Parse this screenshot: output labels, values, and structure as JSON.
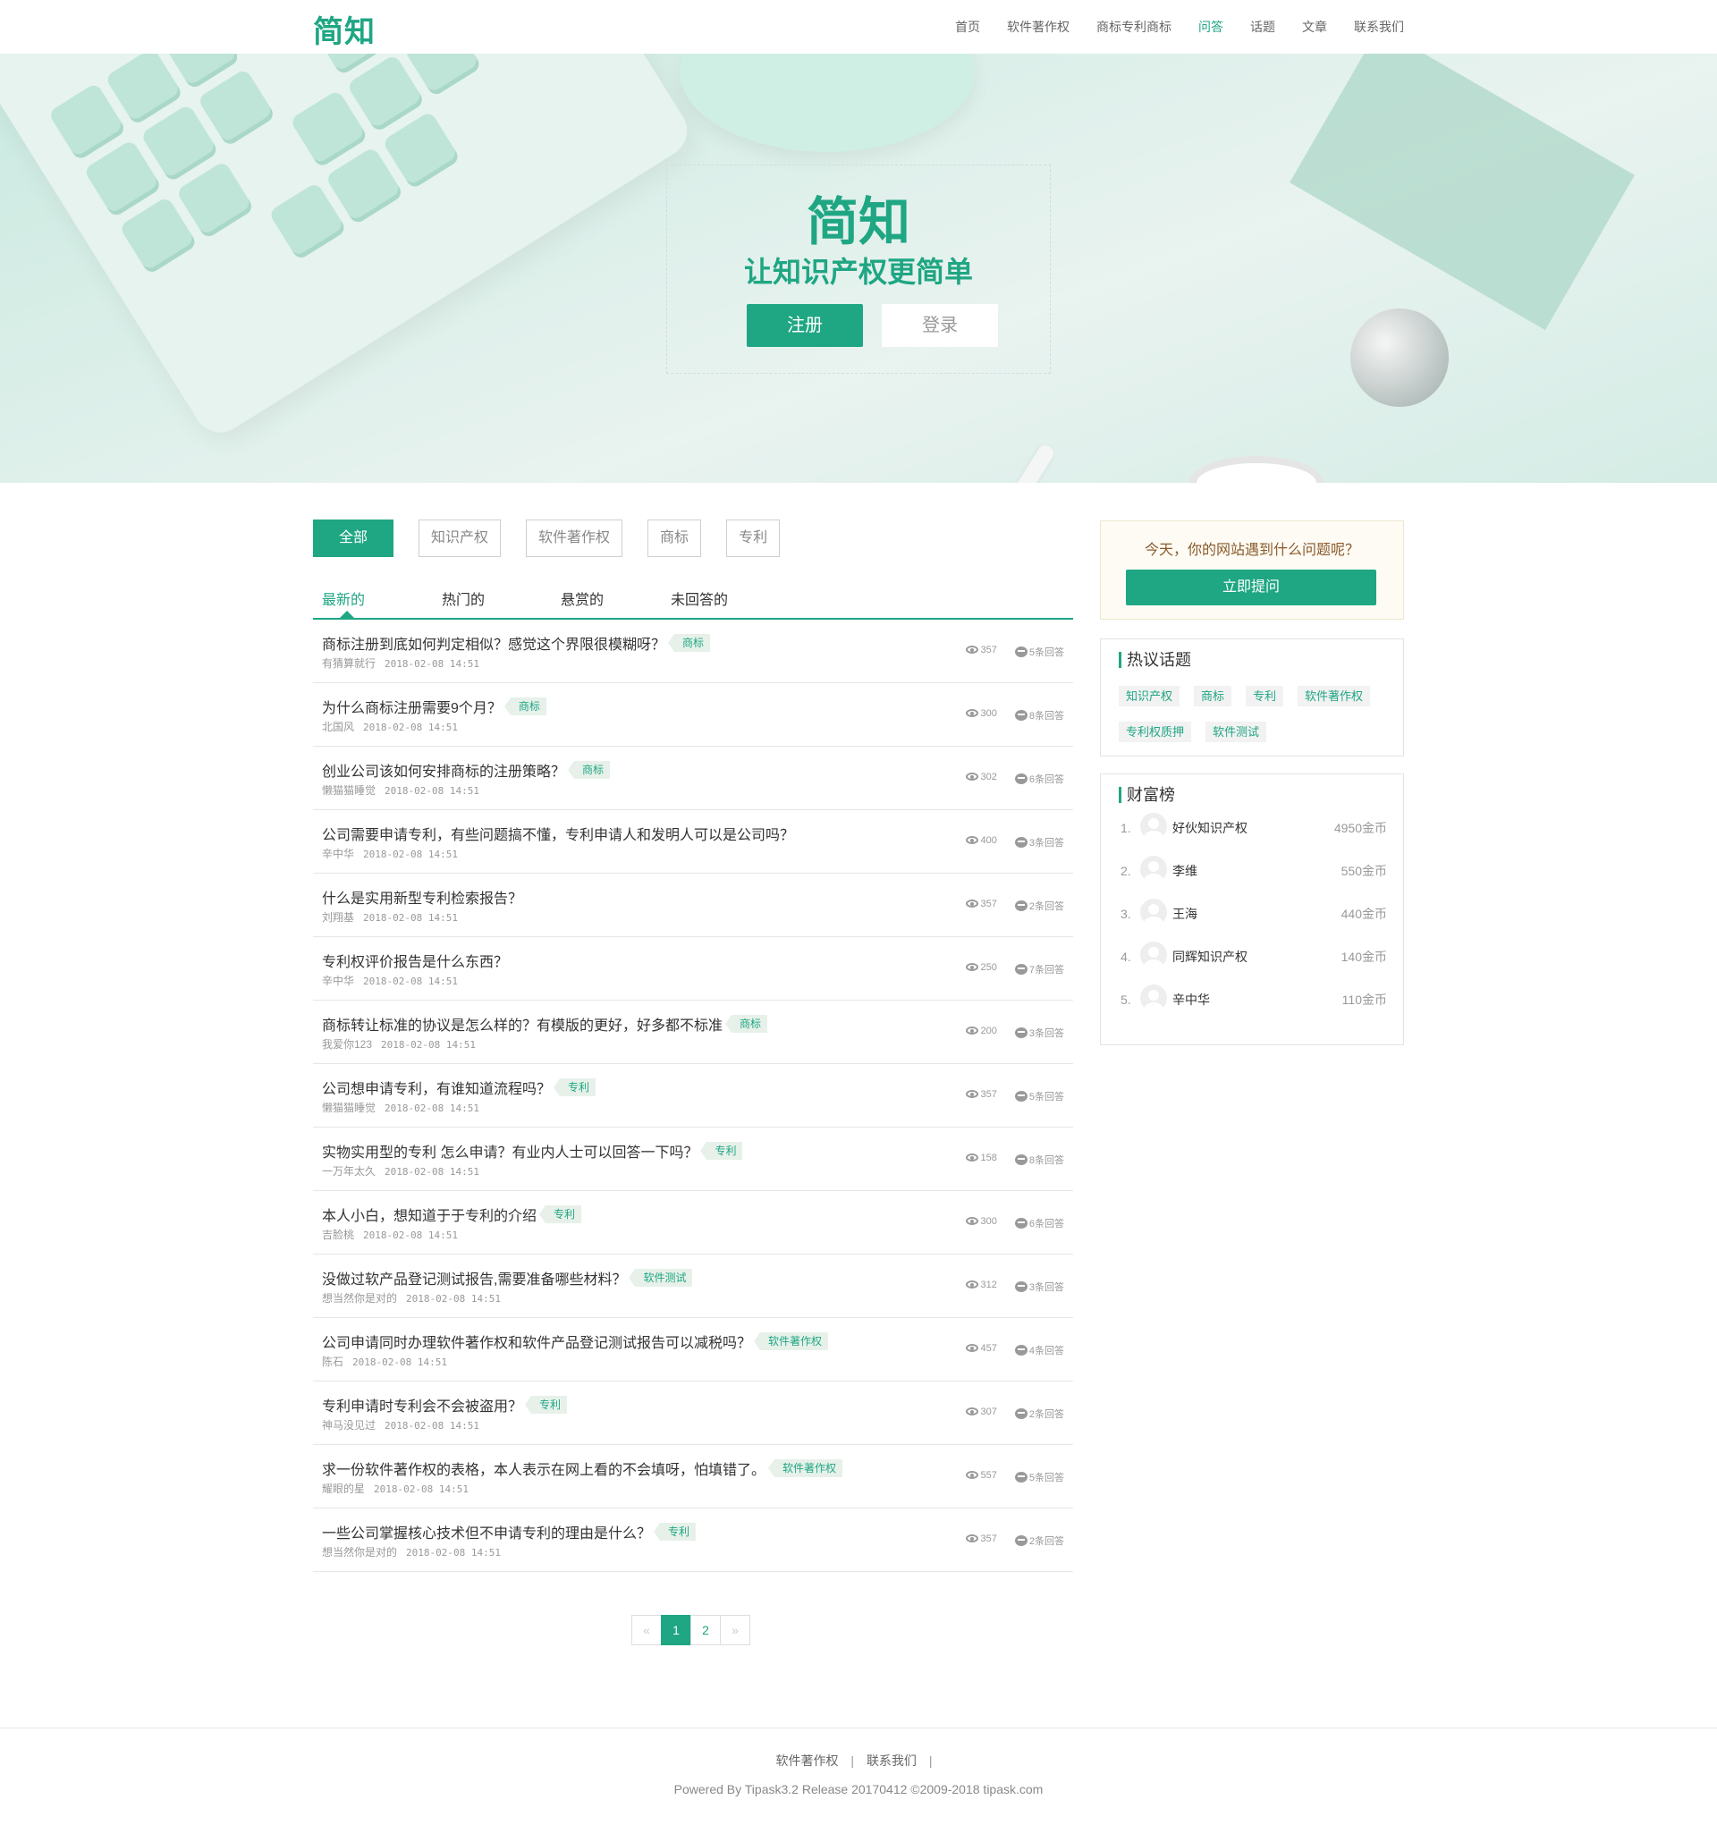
{
  "header": {
    "logo": "简知",
    "nav": [
      "首页",
      "软件著作权",
      "商标专利商标",
      "问答",
      "话题",
      "文章",
      "联系我们"
    ],
    "active_nav": "问答"
  },
  "hero": {
    "title": "简知",
    "subtitle": "让知识产权更简单",
    "register_label": "注册",
    "login_label": "登录"
  },
  "filters": [
    "全部",
    "知识产权",
    "软件著作权",
    "商标",
    "专利"
  ],
  "tabs": [
    "最新的",
    "热门的",
    "悬赏的",
    "未回答的"
  ],
  "questions": [
    {
      "title": "商标注册到底如何判定相似？感觉这个界限很模糊呀？",
      "tag": "商标",
      "author": "有猜算就行",
      "time": "2018-02-08 14:51",
      "views": "357",
      "answers": "5条回答"
    },
    {
      "title": "为什么商标注册需要9个月？",
      "tag": "商标",
      "author": "北国风",
      "time": "2018-02-08 14:51",
      "views": "300",
      "answers": "8条回答"
    },
    {
      "title": "创业公司该如何安排商标的注册策略？",
      "tag": "商标",
      "author": "懒猫猫睡觉",
      "time": "2018-02-08 14:51",
      "views": "302",
      "answers": "6条回答"
    },
    {
      "title": "公司需要申请专利，有些问题搞不懂，专利申请人和发明人可以是公司吗？",
      "tag": "",
      "author": "辛中华",
      "time": "2018-02-08 14:51",
      "views": "400",
      "answers": "3条回答"
    },
    {
      "title": "什么是实用新型专利检索报告？",
      "tag": "",
      "author": "刘翔基",
      "time": "2018-02-08 14:51",
      "views": "357",
      "answers": "2条回答"
    },
    {
      "title": "专利权评价报告是什么东西？",
      "tag": "",
      "author": "辛中华",
      "time": "2018-02-08 14:51",
      "views": "250",
      "answers": "7条回答"
    },
    {
      "title": "商标转让标准的协议是怎么样的？有模版的更好，好多都不标准",
      "tag": "商标",
      "author": "我爱你123",
      "time": "2018-02-08 14:51",
      "views": "200",
      "answers": "3条回答"
    },
    {
      "title": "公司想申请专利，有谁知道流程吗？",
      "tag": "专利",
      "author": "懒猫猫睡觉",
      "time": "2018-02-08 14:51",
      "views": "357",
      "answers": "5条回答"
    },
    {
      "title": "实物实用型的专利 怎么申请？有业内人士可以回答一下吗？",
      "tag": "专利",
      "author": "一万年太久",
      "time": "2018-02-08 14:51",
      "views": "158",
      "answers": "8条回答"
    },
    {
      "title": "本人小白，想知道于于专利的介绍",
      "tag": "专利",
      "author": "吉脸桃",
      "time": "2018-02-08 14:51",
      "views": "300",
      "answers": "6条回答"
    },
    {
      "title": "没做过软产品登记测试报告,需要准备哪些材料？",
      "tag": "软件测试",
      "author": "想当然你是对的",
      "time": "2018-02-08 14:51",
      "views": "312",
      "answers": "3条回答"
    },
    {
      "title": "公司申请同时办理软件著作权和软件产品登记测试报告可以减税吗？",
      "tag": "软件著作权",
      "author": "陈石",
      "time": "2018-02-08 14:51",
      "views": "457",
      "answers": "4条回答"
    },
    {
      "title": "专利申请时专利会不会被盗用？",
      "tag": "专利",
      "author": "神马没见过",
      "time": "2018-02-08 14:51",
      "views": "307",
      "answers": "2条回答"
    },
    {
      "title": "求一份软件著作权的表格，本人表示在网上看的不会填呀，怕填错了。",
      "tag": "软件著作权",
      "author": "耀眼的星",
      "time": "2018-02-08 14:51",
      "views": "557",
      "answers": "5条回答"
    },
    {
      "title": "一些公司掌握核心技术但不申请专利的理由是什么？",
      "tag": "专利",
      "author": "想当然你是对的",
      "time": "2018-02-08 14:51",
      "views": "357",
      "answers": "2条回答"
    }
  ],
  "pagination": {
    "prev": "«",
    "pages": [
      "1",
      "2"
    ],
    "current": "1",
    "next": "»"
  },
  "sidebar": {
    "ask_text": "今天，你的网站遇到什么问题呢？",
    "ask_button": "立即提问",
    "hot_title": "热议话题",
    "hot_topics": [
      "知识产权",
      "商标",
      "专利",
      "软件著作权",
      "专利权质押",
      "软件测试"
    ],
    "rich_title": "财富榜",
    "rich_list": [
      {
        "rank": "1.",
        "name": "好伙知识产权",
        "coins": "4950金币"
      },
      {
        "rank": "2.",
        "name": "李维",
        "coins": "550金币"
      },
      {
        "rank": "3.",
        "name": "王海",
        "coins": "440金币"
      },
      {
        "rank": "4.",
        "name": "同辉知识产权",
        "coins": "140金币"
      },
      {
        "rank": "5.",
        "name": "辛中华",
        "coins": "110金币"
      }
    ]
  },
  "footer": {
    "links": [
      "软件著作权",
      "联系我们"
    ],
    "separator": "|",
    "powered": "Powered By Tipask3.2 Release 20170412 ©2009-2018 tipask.com"
  },
  "colors": {
    "accent": "#1fa683",
    "tag_bg": "#e7f1ea",
    "ask_bg": "#fdfbf3"
  }
}
